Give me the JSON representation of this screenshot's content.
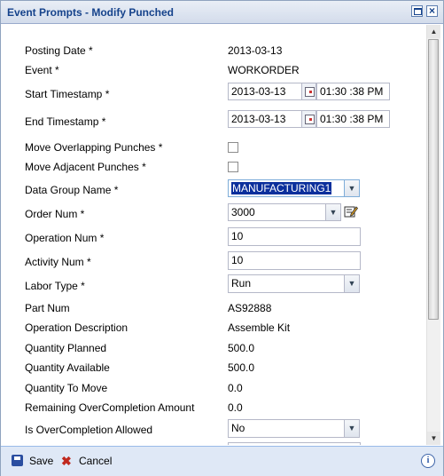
{
  "window": {
    "title": "Event Prompts - Modify Punched"
  },
  "form": {
    "posting_date": {
      "label": "Posting Date *",
      "value": "2013-03-13"
    },
    "event": {
      "label": "Event *",
      "value": "WORKORDER"
    },
    "start_timestamp": {
      "label": "Start Timestamp *",
      "date": "2013-03-13",
      "time": "01:30 :38 PM"
    },
    "end_timestamp": {
      "label": "End Timestamp *",
      "date": "2013-03-13",
      "time": "01:30 :38 PM"
    },
    "move_overlapping": {
      "label": "Move Overlapping Punches *",
      "checked": false
    },
    "move_adjacent": {
      "label": "Move Adjacent Punches *",
      "checked": false
    },
    "data_group": {
      "label": "Data Group Name *",
      "value": "MANUFACTURING1"
    },
    "order_num": {
      "label": "Order Num *",
      "value": "3000"
    },
    "operation_num": {
      "label": "Operation Num *",
      "value": "10"
    },
    "activity_num": {
      "label": "Activity Num *",
      "value": "10"
    },
    "labor_type": {
      "label": "Labor Type *",
      "value": "Run"
    },
    "part_num": {
      "label": "Part Num",
      "value": "AS92888"
    },
    "operation_desc": {
      "label": "Operation Description",
      "value": "Assemble Kit"
    },
    "qty_planned": {
      "label": "Quantity Planned",
      "value": "500.0"
    },
    "qty_available": {
      "label": "Quantity Available",
      "value": "500.0"
    },
    "qty_to_move": {
      "label": "Quantity To Move",
      "value": "0.0"
    },
    "remaining_overcompletion": {
      "label": "Remaining OverCompletion Amount",
      "value": "0.0"
    },
    "is_overcompletion_allowed": {
      "label": "Is OverCompletion Allowed",
      "value": "No"
    }
  },
  "footer": {
    "save_label": "Save",
    "cancel_label": "Cancel"
  },
  "icons": {
    "maximize": "maximize-icon",
    "close": "close-icon",
    "calendar": "calendar-icon",
    "dropdown": "chevron-down-icon",
    "edit": "edit-list-icon",
    "save": "save-icon",
    "cancel": "cancel-x-icon",
    "info": "info-icon"
  },
  "colors": {
    "title_text": "#15428b",
    "selection": "#0b2f9c",
    "footer_bg": "#dfe8f6"
  }
}
